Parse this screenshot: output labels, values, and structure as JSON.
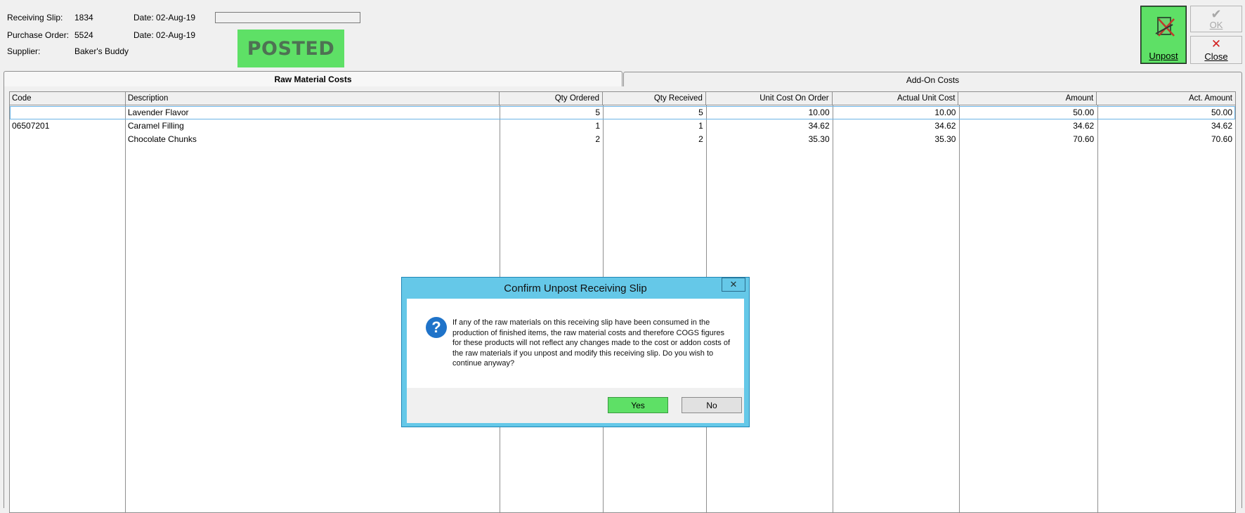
{
  "header": {
    "receiving_slip_label": "Receiving Slip:",
    "receiving_slip_value": "1834",
    "receiving_date_label": "Date: 02-Aug-19",
    "purchase_order_label": "Purchase Order:",
    "purchase_order_value": "5524",
    "purchase_date_label": "Date: 02-Aug-19",
    "supplier_label": "Supplier:",
    "supplier_value": "Baker's Buddy",
    "status_badge": "POSTED"
  },
  "toolbar": {
    "unpost_label": "Unpost",
    "ok_label": "OK",
    "close_label": "Close"
  },
  "tabs": [
    {
      "label": "Raw Material Costs",
      "active": true
    },
    {
      "label": "Add-On Costs",
      "active": false
    }
  ],
  "grid": {
    "columns": [
      "Code",
      "Description",
      "Qty Ordered",
      "Qty Received",
      "Unit Cost On Order",
      "Actual Unit Cost",
      "Amount",
      "Act. Amount"
    ],
    "rows": [
      [
        "",
        "Lavender Flavor",
        "5",
        "5",
        "10.00",
        "10.00",
        "50.00",
        "50.00"
      ],
      [
        "06507201",
        "Caramel Filling",
        "1",
        "1",
        "34.62",
        "34.62",
        "34.62",
        "34.62"
      ],
      [
        "",
        "Chocolate Chunks",
        "2",
        "2",
        "35.30",
        "35.30",
        "70.60",
        "70.60"
      ]
    ]
  },
  "dialog": {
    "title": "Confirm Unpost Receiving Slip",
    "close_glyph": "✕",
    "icon": "question-icon",
    "message": "If any of the raw materials on this receiving slip have been consumed in the production of finished items, the raw material costs and therefore COGS figures for these products will not reflect any changes made to the cost or addon costs of the raw materials if you unpost and modify this receiving slip. Do you wish to continue anyway?",
    "yes_label": "Yes",
    "no_label": "No"
  },
  "colors": {
    "accent_green": "#5ee066",
    "dialog_frame": "#65c8e8",
    "question_icon": "#1f73c9"
  }
}
